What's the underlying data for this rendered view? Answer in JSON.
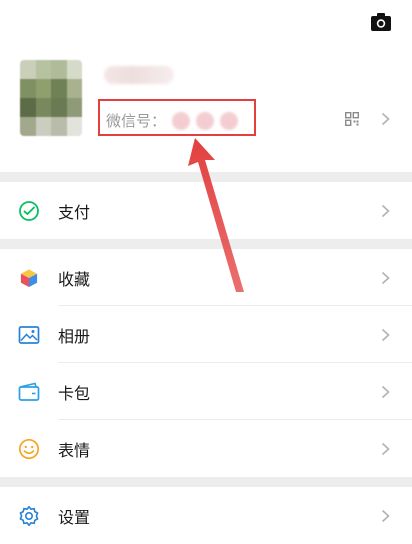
{
  "profile": {
    "wechat_id_label": "微信号：",
    "icons": {
      "camera": "camera-icon",
      "qr": "qr-code-icon",
      "arrow": "chevron-right-icon"
    }
  },
  "menu": {
    "pay": {
      "label": "支付",
      "icon": "wallet-check-icon",
      "color": "#07c160"
    },
    "favorites": {
      "label": "收藏",
      "icon": "cube-icon"
    },
    "album": {
      "label": "相册",
      "icon": "image-icon",
      "color": "#2782d7"
    },
    "cards": {
      "label": "卡包",
      "icon": "card-icon",
      "color": "#2aa0e8"
    },
    "stickers": {
      "label": "表情",
      "icon": "smiley-icon",
      "color": "#f5a623"
    },
    "settings": {
      "label": "设置",
      "icon": "gear-icon",
      "color": "#2782d7"
    }
  },
  "colors": {
    "background": "#ededed",
    "surface": "#ffffff",
    "annotation": "#e2403f",
    "muted_text": "#9a9a9a"
  }
}
